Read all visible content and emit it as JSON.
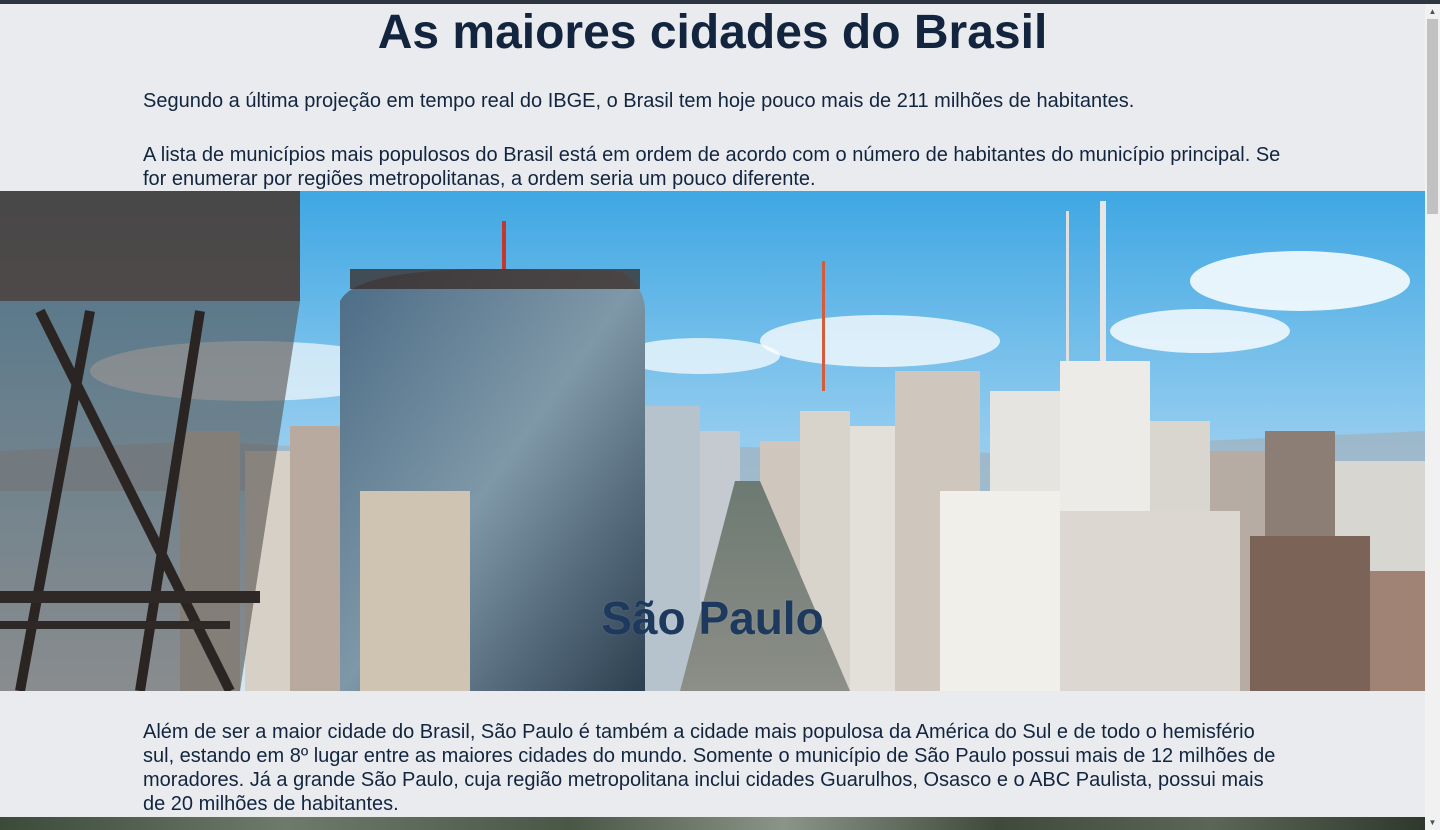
{
  "page": {
    "title": "As maiores cidades do Brasil",
    "intro_1": "Segundo a última projeção em tempo real do IBGE, o Brasil tem hoje pouco mais de 211 milhões de habitantes.",
    "intro_2": "A lista de municípios mais populosos do Brasil está em ordem de acordo com o número de habitantes do município principal. Se for enumerar por regiões metropolitanas, a ordem seria um pouco diferente."
  },
  "sections": [
    {
      "city": "São Paulo",
      "description": "Além de ser a maior cidade do Brasil, São Paulo é também a cidade mais populosa da América do Sul e de todo o hemisfério sul, estando em 8º lugar entre as maiores cidades do mundo. Somente o município de São Paulo possui mais de 12 milhões de moradores. Já a grande São Paulo, cuja região metropolitana inclui cidades Guarulhos, Osasco e o ABC Paulista, possui mais de 20 milhões de habitantes."
    }
  ],
  "scrollbar": {
    "up_icon": "▲",
    "down_icon": "▼"
  },
  "colors": {
    "text": "#13253e",
    "background": "#e9ebee",
    "hero_title": "#1d3a5e"
  }
}
